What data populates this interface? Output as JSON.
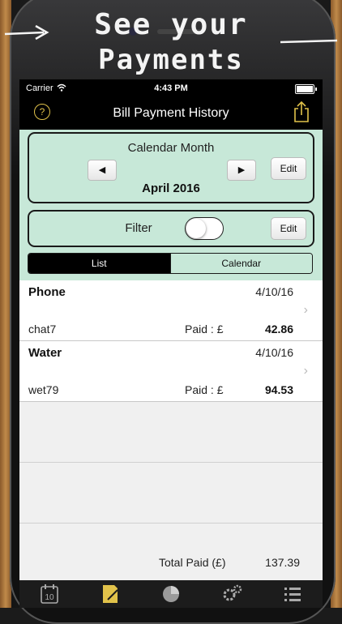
{
  "promo": {
    "line1": "See your",
    "line2": "Payments"
  },
  "status_bar": {
    "carrier": "Carrier",
    "time": "4:43 PM"
  },
  "nav": {
    "title": "Bill Payment History",
    "help_label": "?"
  },
  "month_box": {
    "label": "Calendar Month",
    "value": "April 2016",
    "prev_label": "◀",
    "next_label": "▶",
    "edit_label": "Edit"
  },
  "filter_box": {
    "label": "Filter",
    "toggle_on": false,
    "edit_label": "Edit"
  },
  "view_toggle": {
    "list_label": "List",
    "calendar_label": "Calendar",
    "selected": "List"
  },
  "payments": [
    {
      "name": "Phone",
      "date": "4/10/16",
      "ref": "chat7",
      "paid_label": "Paid : £",
      "amount": "42.86"
    },
    {
      "name": "Water",
      "date": "4/10/16",
      "ref": "wet79",
      "paid_label": "Paid : £",
      "amount": "94.53"
    }
  ],
  "total": {
    "label": "Total Paid (£)",
    "value": "137.39"
  },
  "tabs": [
    {
      "icon": "calendar-10-icon",
      "label": "10"
    },
    {
      "icon": "bill-edit-icon"
    },
    {
      "icon": "pie-chart-icon"
    },
    {
      "icon": "gears-icon"
    },
    {
      "icon": "list-icon"
    }
  ],
  "colors": {
    "panel_bg": "#c7e8d8",
    "accent_yellow": "#e1c24a"
  }
}
